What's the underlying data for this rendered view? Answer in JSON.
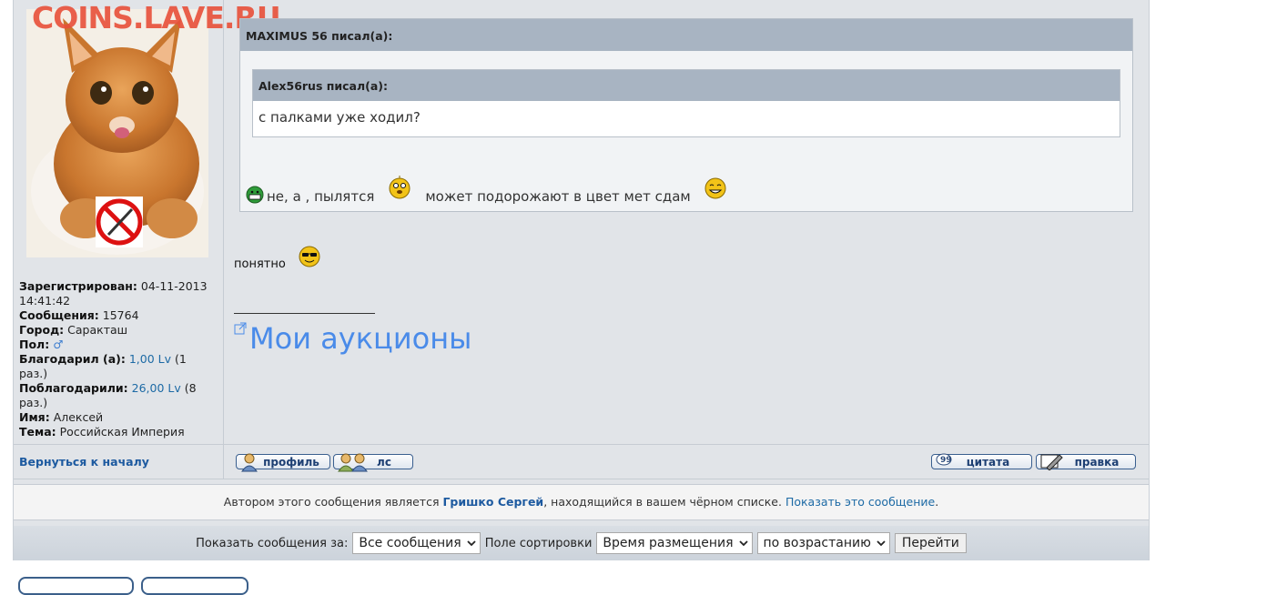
{
  "watermark": "COINS.LAVE.RU",
  "user": {
    "registered_label": "Зарегистрирован:",
    "registered_value": "04-11-2013 14:41:42",
    "messages_label": "Сообщения:",
    "messages_value": "15764",
    "city_label": "Город:",
    "city_value": "Саракташ",
    "gender_label": "Пол:",
    "thanked_label": "Благодарил (а):",
    "thanked_value": "1,00 Lv",
    "thanked_times": "(1 раз.)",
    "was_thanked_label": "Поблагодарили:",
    "was_thanked_value": "26,00 Lv",
    "was_thanked_times": "(8 раз.)",
    "name_label": "Имя:",
    "name_value": "Алексей",
    "topic_label": "Тема:",
    "topic_value": "Российская Империя"
  },
  "quote_outer": {
    "header": "MAXIMUS 56 писал(а):",
    "reply_part1": "не, а , пылятся",
    "reply_part2": "может подорожают в цвет мет сдам"
  },
  "quote_inner": {
    "header": "Alex56rus писал(а):",
    "text": "с палками уже ходил?"
  },
  "post": {
    "text": "понятно",
    "signature_link": "Мои аукционы"
  },
  "bottombar": {
    "back_to_top": "Вернуться к началу",
    "profile_btn": "профиль",
    "pm_btn": "лс",
    "quote_btn": "цитата",
    "edit_btn": "правка"
  },
  "notice": {
    "prefix": "Автором этого сообщения является ",
    "author": "Гришко Сергей",
    "middle": ", находящийся в вашем чёрном списке. ",
    "show_link": "Показать это сообщение",
    "suffix": "."
  },
  "filters": {
    "show_label": "Показать сообщения за:",
    "period_value": "Все сообщения",
    "sort_label": "Поле сортировки",
    "sort_field_value": "Время размещения",
    "order_value": "по возрастанию",
    "go_button": "Перейти"
  }
}
